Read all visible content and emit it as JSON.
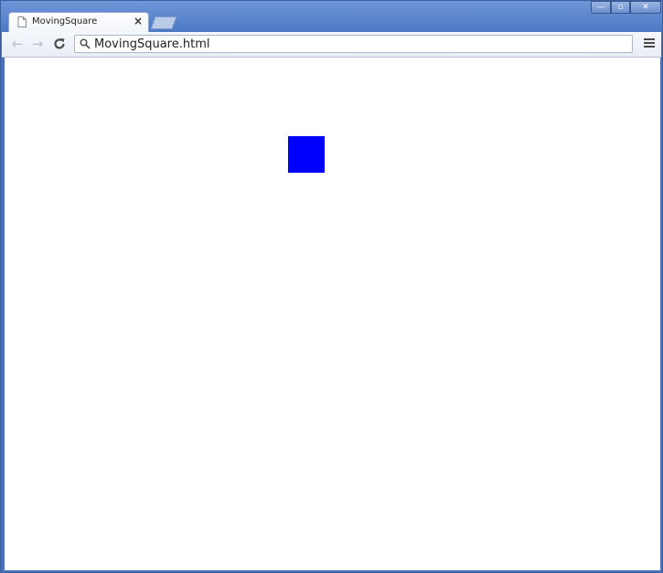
{
  "window": {
    "controls": {
      "minimize": "—",
      "maximize": "▫",
      "close": "✕"
    }
  },
  "tab": {
    "title": "MovingSquare",
    "close_label": "×",
    "favicon": "document-icon"
  },
  "toolbar": {
    "back_label": "←",
    "forward_label": "→",
    "reload_label": "C",
    "address": "MovingSquare.html",
    "address_icon": "search-icon",
    "menu_icon": "hamburger-menu-icon"
  },
  "content": {
    "square_color": "#0000ff"
  }
}
